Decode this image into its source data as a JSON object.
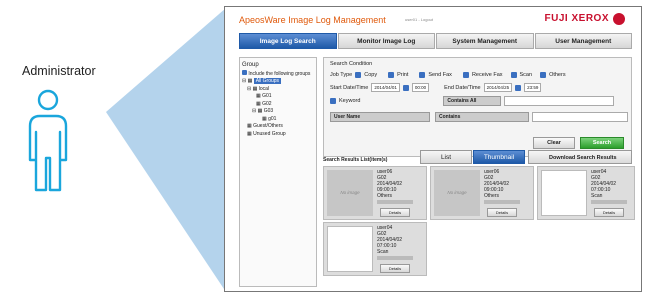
{
  "actor": {
    "label": "Administrator"
  },
  "app": {
    "title": "ApeosWare Image Log Management",
    "user": "user01 - Logout",
    "brand": "FUJI XEROX"
  },
  "tabs": [
    "Image Log Search",
    "Monitor Image Log",
    "System Management",
    "User Management"
  ],
  "group": {
    "title": "Group",
    "include_label": "Include the following groups",
    "items": [
      "All Groups",
      "local",
      "G01",
      "G02",
      "G03",
      "g01",
      "Guest/Others",
      "Unused Group"
    ]
  },
  "condition": {
    "title": "Search Condition",
    "job_type_label": "Job Type",
    "job_types": [
      "Copy",
      "Print",
      "Send Fax",
      "Receive Fax",
      "Scan",
      "Others"
    ],
    "start_label": "Start Date/Time",
    "start_date": "2014/04/01",
    "start_time": "00:00",
    "end_label": "End Date/Time",
    "end_date": "2014/04/25",
    "end_time": "23:59",
    "keyword_label": "Keyword",
    "keyword_op": "Contains All",
    "field": "User Name",
    "field_op": "Contains",
    "clear": "Clear",
    "search": "Search"
  },
  "results": {
    "title": "Search Results List(item(s)",
    "view_list": "List",
    "view_thumb": "Thumbnail",
    "download": "Download Search Results",
    "cards": [
      {
        "thumb": "No image",
        "user": "user06",
        "group": "G02",
        "date": "2014/04/02",
        "time": "09:00:10",
        "type": "Others",
        "details": "Details"
      },
      {
        "thumb": "No image",
        "user": "user06",
        "group": "G02",
        "date": "2014/04/02",
        "time": "09:00:10",
        "type": "Others",
        "details": "Details"
      },
      {
        "thumb": "",
        "user": "user04",
        "group": "G02",
        "date": "2014/04/02",
        "time": "07:00:10",
        "type": "Scan",
        "details": "Details"
      },
      {
        "thumb": "",
        "user": "user04",
        "group": "G02",
        "date": "2014/04/02",
        "time": "07:00:10",
        "type": "Scan",
        "details": "Details"
      }
    ]
  }
}
